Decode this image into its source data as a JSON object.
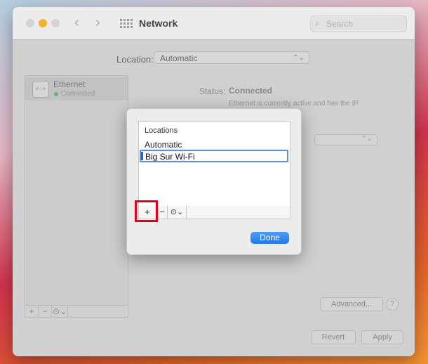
{
  "window": {
    "title": "Network",
    "search_placeholder": "Search"
  },
  "location": {
    "label": "Location:",
    "value": "Automatic"
  },
  "sidebar": {
    "items": [
      {
        "name": "Ethernet",
        "status": "Connected"
      }
    ],
    "controls": [
      "+",
      "−",
      "⊙⌄"
    ]
  },
  "detail": {
    "status_label": "Status:",
    "status_value": "Connected",
    "status_description": "Ethernet is currently active and has the IP",
    "advanced_label": "Advanced...",
    "help_label": "?",
    "revert_label": "Revert",
    "apply_label": "Apply"
  },
  "dialog": {
    "list_header": "Locations",
    "locations": [
      "Automatic"
    ],
    "editing_value": "Big Sur Wi-Fi",
    "add_label": "+",
    "remove_label": "−",
    "action_label": "⊙⌄",
    "done_label": "Done"
  },
  "colors": {
    "accent": "#1f7aeb",
    "highlight": "#e3001b",
    "traffic_yellow": "#f3b42d"
  }
}
